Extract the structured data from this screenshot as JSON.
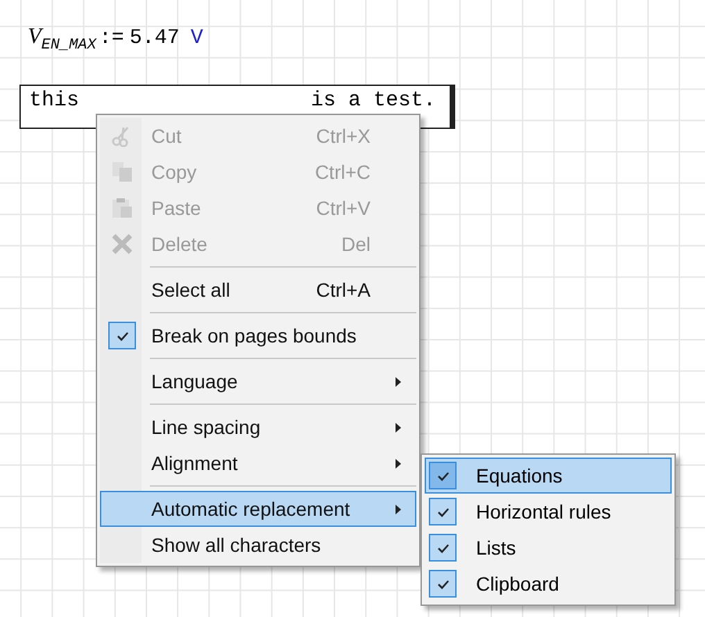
{
  "equation": {
    "variable": "V",
    "subscript": "EN_MAX",
    "operator": ":=",
    "value": "5.47",
    "unit": "V"
  },
  "text_field": {
    "segments": [
      {
        "text": "this"
      },
      {
        "text": "is a test."
      }
    ]
  },
  "context_menu": {
    "items": [
      {
        "kind": "item",
        "label": "Cut",
        "shortcut": "Ctrl+X",
        "disabled": true
      },
      {
        "kind": "item",
        "label": "Copy",
        "shortcut": "Ctrl+C",
        "disabled": true
      },
      {
        "kind": "item",
        "label": "Paste",
        "shortcut": "Ctrl+V",
        "disabled": true
      },
      {
        "kind": "item",
        "label": "Delete",
        "shortcut": "Del",
        "disabled": true
      },
      {
        "kind": "separator"
      },
      {
        "kind": "item",
        "label": "Select all",
        "shortcut": "Ctrl+A",
        "disabled": false
      },
      {
        "kind": "separator"
      },
      {
        "kind": "item",
        "label": "Break on pages bounds",
        "checked": true,
        "disabled": false
      },
      {
        "kind": "separator"
      },
      {
        "kind": "item",
        "label": "Language",
        "submenu": true,
        "disabled": false
      },
      {
        "kind": "separator"
      },
      {
        "kind": "item",
        "label": "Line spacing",
        "submenu": true,
        "disabled": false
      },
      {
        "kind": "item",
        "label": "Alignment",
        "submenu": true,
        "disabled": false
      },
      {
        "kind": "separator"
      },
      {
        "kind": "item",
        "label": "Automatic replacement",
        "submenu": true,
        "selected": true,
        "disabled": false
      },
      {
        "kind": "item",
        "label": "Show all characters",
        "disabled": false
      }
    ]
  },
  "submenu": {
    "items": [
      {
        "label": "Equations",
        "checked": true,
        "selected": true
      },
      {
        "label": "Horizontal rules",
        "checked": true,
        "selected": false
      },
      {
        "label": "Lists",
        "checked": true,
        "selected": false
      },
      {
        "label": "Clipboard",
        "checked": true,
        "selected": false
      }
    ]
  }
}
